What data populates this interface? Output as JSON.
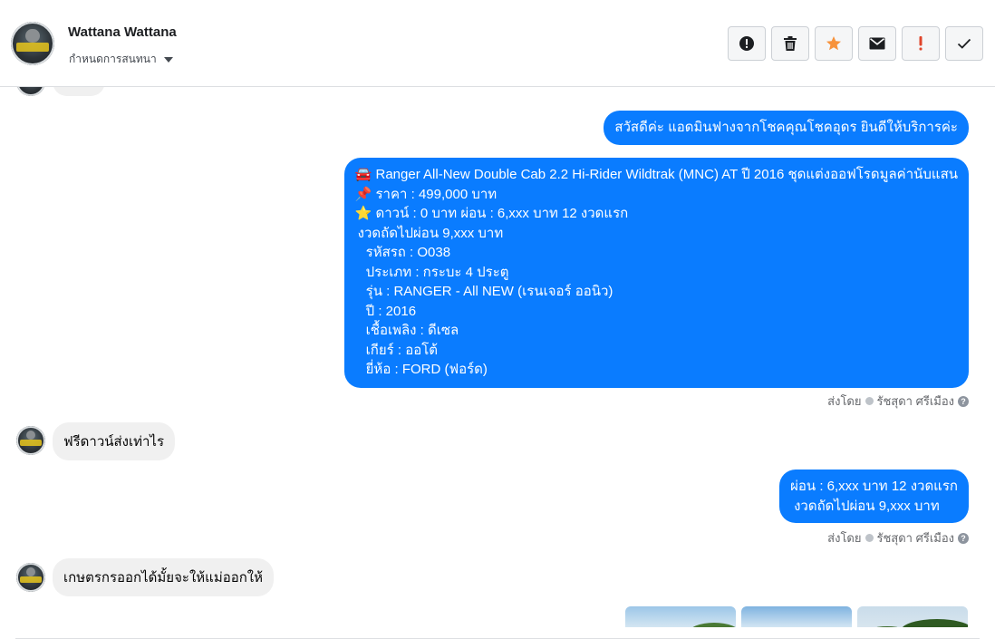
{
  "header": {
    "name": "Wattana Wattana",
    "assign_label": "กำหนดการสนทนา",
    "actions": [
      {
        "icon": "alert-circle-icon",
        "color": "#1c1e21"
      },
      {
        "icon": "trash-icon",
        "color": "#1c1e21"
      },
      {
        "icon": "star-icon",
        "color": "#f7923b"
      },
      {
        "icon": "mail-icon",
        "color": "#1c1e21"
      },
      {
        "icon": "exclamation-icon",
        "color": "#e0452b"
      },
      {
        "icon": "check-icon",
        "color": "#1c1e21"
      }
    ]
  },
  "messages": {
    "greeting": "สวัสดีค่ะ แอดมินฟางจากโชคคุณโชคอุดร ยินดีให้บริการค่ะ",
    "listing": {
      "emoji_car": "🚘",
      "emoji_pin": "📌",
      "emoji_star": "⭐",
      "line1": "Ranger All-New Double Cab 2.2 Hi-Rider Wildtrak (MNC) AT ปี 2016 ชุดแต่งออฟโรดมูลค่านับแสน",
      "line2": "ราคา : 499,000 บาท",
      "line3": "ดาวน์ : 0 บาท ผ่อน : 6,xxx บาท 12 งวดแรก",
      "line4": "งวดถัดไปผ่อน  9,xxx บาท",
      "line5": "รหัสรถ : O038",
      "line6": "ประเภท : กระบะ 4 ประตู",
      "line7": "รุ่น : RANGER - All NEW (เรนเจอร์ ออนิว)",
      "line8": "ปี : 2016",
      "line9": "เชื้อเพลิง : ดีเซล",
      "line10": "เกียร์ : ออโต้",
      "line11": "ยี่ห้อ : FORD (ฟอร์ด)"
    },
    "sent_by_label": "ส่งโดย",
    "sender_name": "รัชสุดา ศรีเมือง",
    "help_mark": "?",
    "customer_q1": "ฟรีดาวน์ส่งเท่าไร",
    "installment_line1": "ผ่อน : 6,xxx บาท 12 งวดแรก",
    "installment_line2": "งวดถัดไปผ่อน  9,xxx บาท",
    "customer_q2": "เกษตรกรออกได้มั้ยจะให้แม่ออกให้"
  },
  "colors": {
    "outgoing_bubble": "#0a7cff",
    "incoming_bubble": "#f0f0f0",
    "divider": "#dddfe2"
  }
}
